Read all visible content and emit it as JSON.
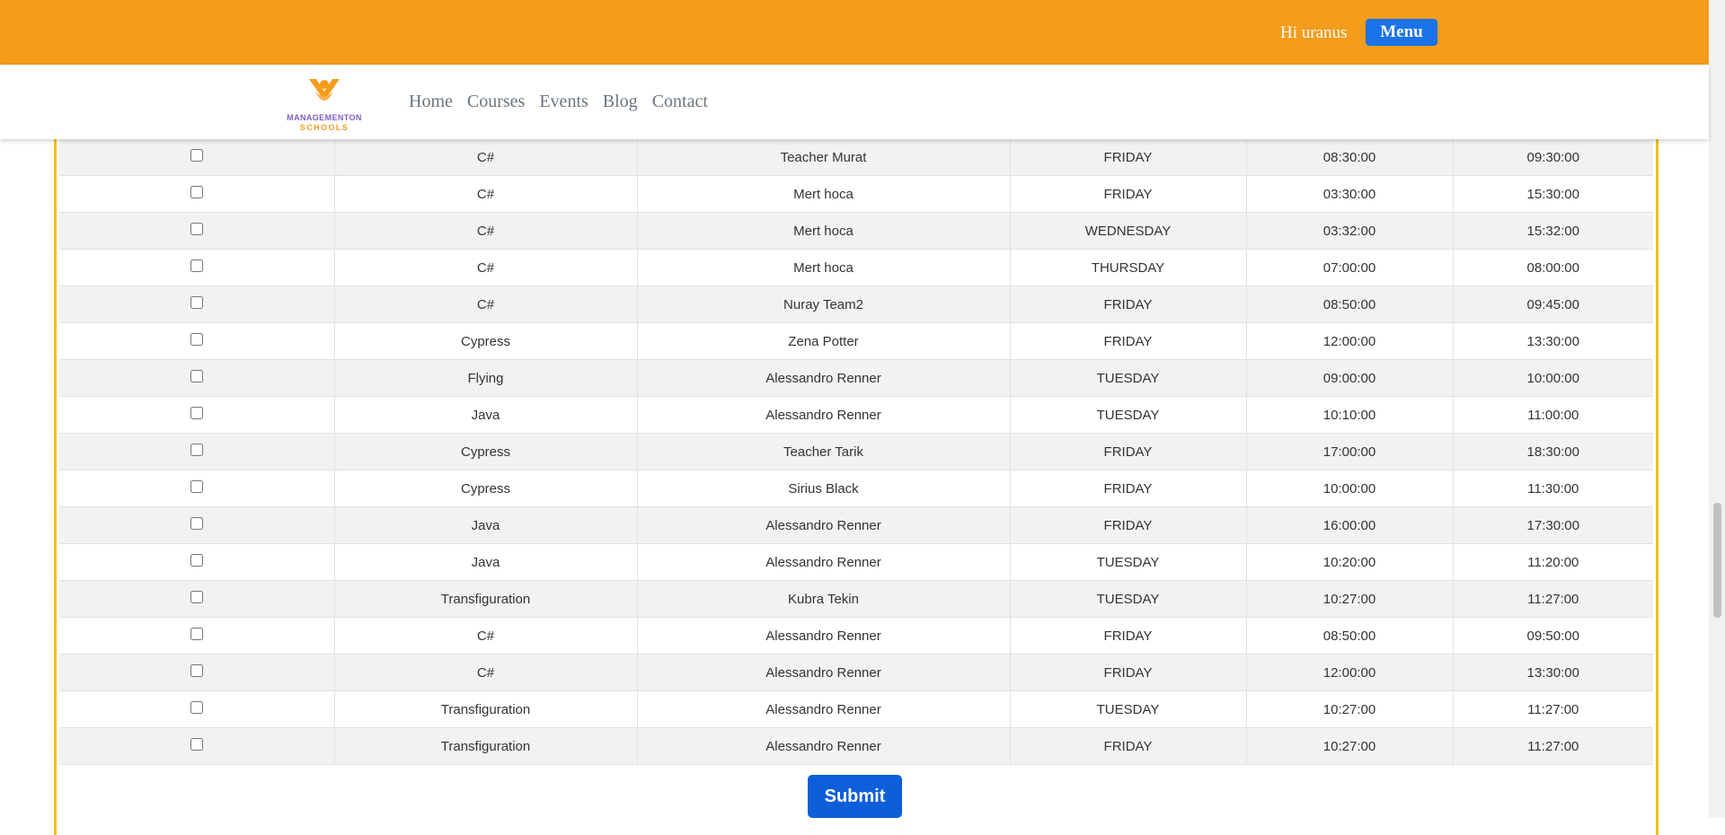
{
  "header": {
    "greeting": "Hi uranus",
    "menu_label": "Menu",
    "accent_color": "#f49c1c",
    "button_color": "#1a73e8"
  },
  "nav": {
    "logo": {
      "line1": "MANAGEMENTON",
      "line2": "SCHOOLS"
    },
    "links": [
      "Home",
      "Courses",
      "Events",
      "Blog",
      "Contact"
    ]
  },
  "table": {
    "rows": [
      [
        "C#",
        "Teacher Murat",
        "FRIDAY",
        "08:30:00",
        "09:30:00"
      ],
      [
        "C#",
        "Mert hoca",
        "FRIDAY",
        "03:30:00",
        "15:30:00"
      ],
      [
        "C#",
        "Mert hoca",
        "WEDNESDAY",
        "03:32:00",
        "15:32:00"
      ],
      [
        "C#",
        "Mert hoca",
        "THURSDAY",
        "07:00:00",
        "08:00:00"
      ],
      [
        "C#",
        "Nuray Team2",
        "FRIDAY",
        "08:50:00",
        "09:45:00"
      ],
      [
        "Cypress",
        "Zena Potter",
        "FRIDAY",
        "12:00:00",
        "13:30:00"
      ],
      [
        "Flying",
        "Alessandro Renner",
        "TUESDAY",
        "09:00:00",
        "10:00:00"
      ],
      [
        "Java",
        "Alessandro Renner",
        "TUESDAY",
        "10:10:00",
        "11:00:00"
      ],
      [
        "Cypress",
        "Teacher Tarik",
        "FRIDAY",
        "17:00:00",
        "18:30:00"
      ],
      [
        "Cypress",
        "Sirius Black",
        "FRIDAY",
        "10:00:00",
        "11:30:00"
      ],
      [
        "Java",
        "Alessandro Renner",
        "FRIDAY",
        "16:00:00",
        "17:30:00"
      ],
      [
        "Java",
        "Alessandro Renner",
        "TUESDAY",
        "10:20:00",
        "11:20:00"
      ],
      [
        "Transfiguration",
        "Kubra Tekin",
        "TUESDAY",
        "10:27:00",
        "11:27:00"
      ],
      [
        "C#",
        "Alessandro Renner",
        "FRIDAY",
        "08:50:00",
        "09:50:00"
      ],
      [
        "C#",
        "Alessandro Renner",
        "FRIDAY",
        "12:00:00",
        "13:30:00"
      ],
      [
        "Transfiguration",
        "Alessandro Renner",
        "TUESDAY",
        "10:27:00",
        "11:27:00"
      ],
      [
        "Transfiguration",
        "Alessandro Renner",
        "FRIDAY",
        "10:27:00",
        "11:27:00"
      ]
    ]
  },
  "submit_label": "Submit"
}
